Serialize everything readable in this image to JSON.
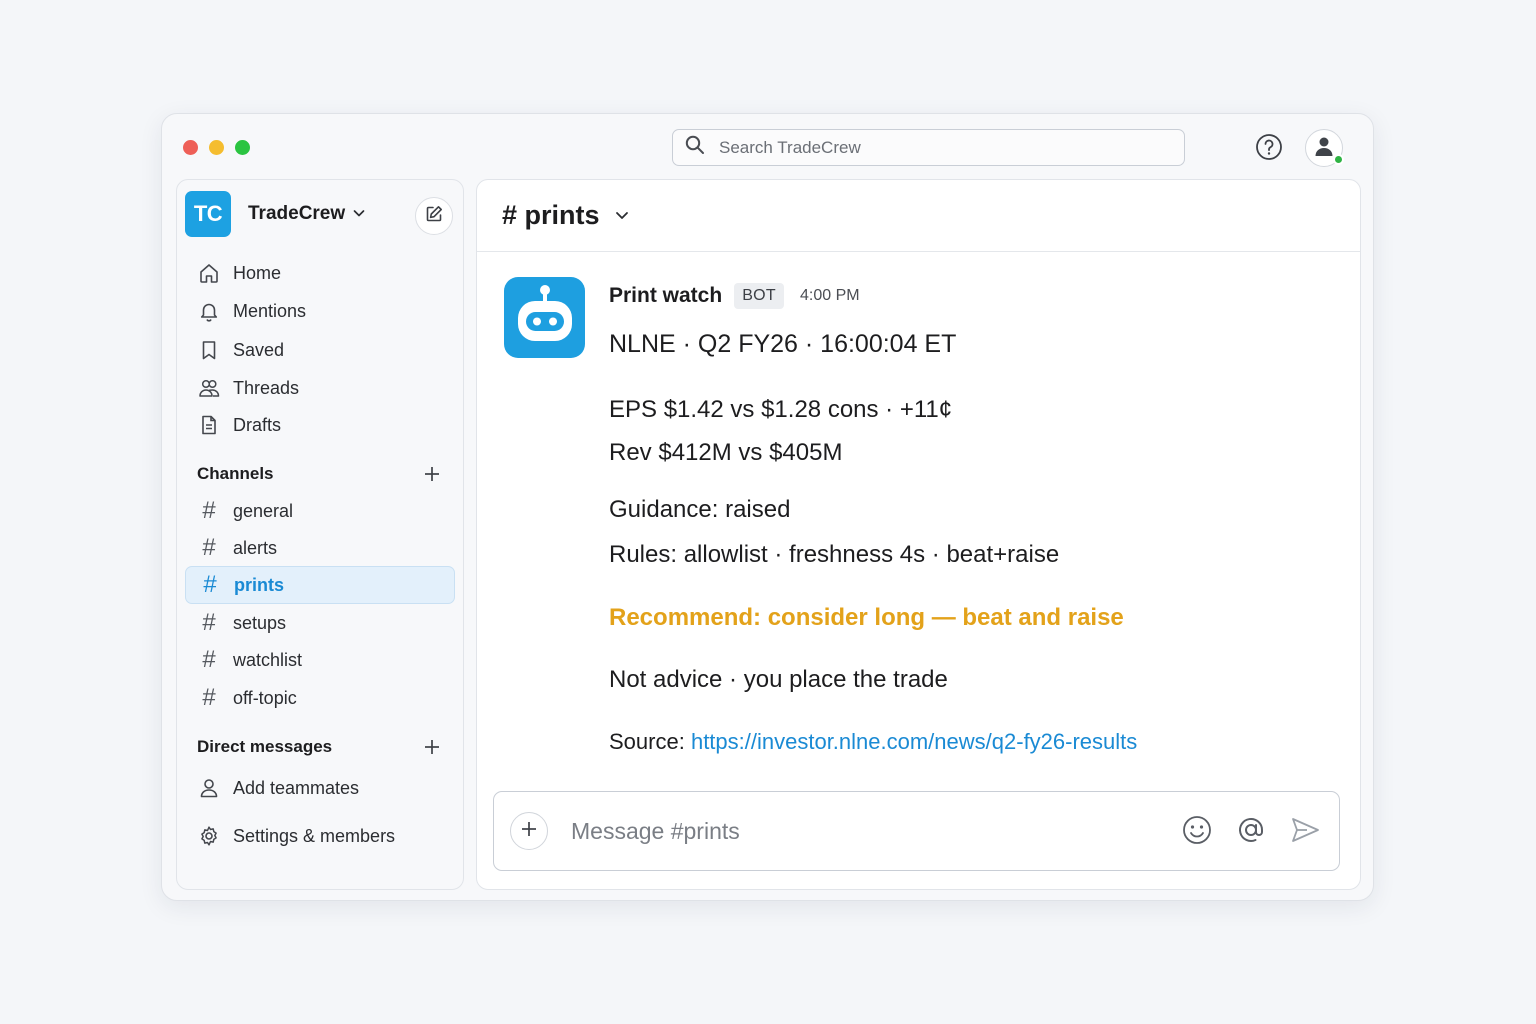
{
  "app": {
    "name": "TradeCrew",
    "initials": "TC"
  },
  "search": {
    "placeholder": "Search TradeCrew"
  },
  "sidebar": {
    "nav": [
      {
        "label": "Home",
        "icon": "home-icon"
      },
      {
        "label": "Mentions",
        "icon": "bell-icon"
      },
      {
        "label": "Saved",
        "icon": "bookmark-icon"
      },
      {
        "label": "Threads",
        "icon": "people-icon"
      },
      {
        "label": "Drafts",
        "icon": "document-icon"
      }
    ],
    "channels_header": "Channels",
    "channels": [
      {
        "label": "general",
        "active": false
      },
      {
        "label": "alerts",
        "active": false
      },
      {
        "label": "prints",
        "active": true
      },
      {
        "label": "setups",
        "active": false
      },
      {
        "label": "watchlist",
        "active": false
      },
      {
        "label": "off-topic",
        "active": false
      }
    ],
    "dm_header": "Direct messages",
    "add_teammates": "Add teammates",
    "settings": "Settings & members"
  },
  "channel": {
    "title": "# prints"
  },
  "message": {
    "sender": "Print watch",
    "badge": "BOT",
    "time": "4:00 PM",
    "headline": "NLNE · Q2 FY26 · 16:00:04 ET",
    "eps": "EPS  $1.42 vs $1.28 cons  ·  +11¢",
    "rev": "Rev  $412M vs $405M",
    "guidance": "Guidance: raised",
    "rules": "Rules: allowlist · freshness 4s · beat+raise",
    "recommend": "Recommend: consider long — beat and raise",
    "disclaimer": "Not advice  ·  you place the trade",
    "source_label": "Source:",
    "source_url": "https://investor.nlne.com/news/q2-fy26-results"
  },
  "composer": {
    "placeholder": "Message #prints"
  },
  "colors": {
    "accent": "#1a8ad4",
    "brand": "#1da1e2",
    "recommend": "#e3a21a",
    "presence": "#2fb344",
    "traffic_red": "#ee5f57",
    "traffic_yellow": "#f5bd2f",
    "traffic_green": "#2bc441"
  }
}
